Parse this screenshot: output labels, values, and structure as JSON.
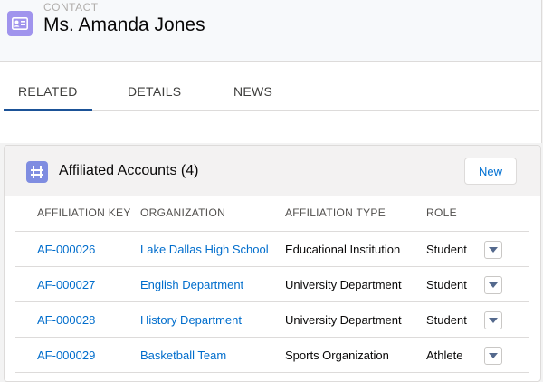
{
  "record": {
    "object_label": "CONTACT",
    "title": "Ms. Amanda Jones",
    "icon": "contact-card-icon"
  },
  "tabs": [
    {
      "label": "RELATED",
      "active": true
    },
    {
      "label": "DETAILS",
      "active": false
    },
    {
      "label": "NEWS",
      "active": false
    }
  ],
  "related_list": {
    "title": "Affiliated Accounts (4)",
    "icon": "affiliations-icon",
    "new_label": "New",
    "columns": [
      "AFFILIATION KEY",
      "ORGANIZATION",
      "AFFILIATION TYPE",
      "ROLE"
    ],
    "rows": [
      {
        "key": "AF-000026",
        "organization": "Lake Dallas High School",
        "type": "Educational Institution",
        "role": "Student"
      },
      {
        "key": "AF-000027",
        "organization": "English Department",
        "type": "University Department",
        "role": "Student"
      },
      {
        "key": "AF-000028",
        "organization": "History Department",
        "type": "University Department",
        "role": "Student"
      },
      {
        "key": "AF-000029",
        "organization": "Basketball Team",
        "type": "Sports Organization",
        "role": "Athlete"
      }
    ]
  },
  "colors": {
    "record_icon": "#a094ed",
    "card_icon": "#7f8de1",
    "link": "#006dcc",
    "active_tab": "#1b5297"
  }
}
